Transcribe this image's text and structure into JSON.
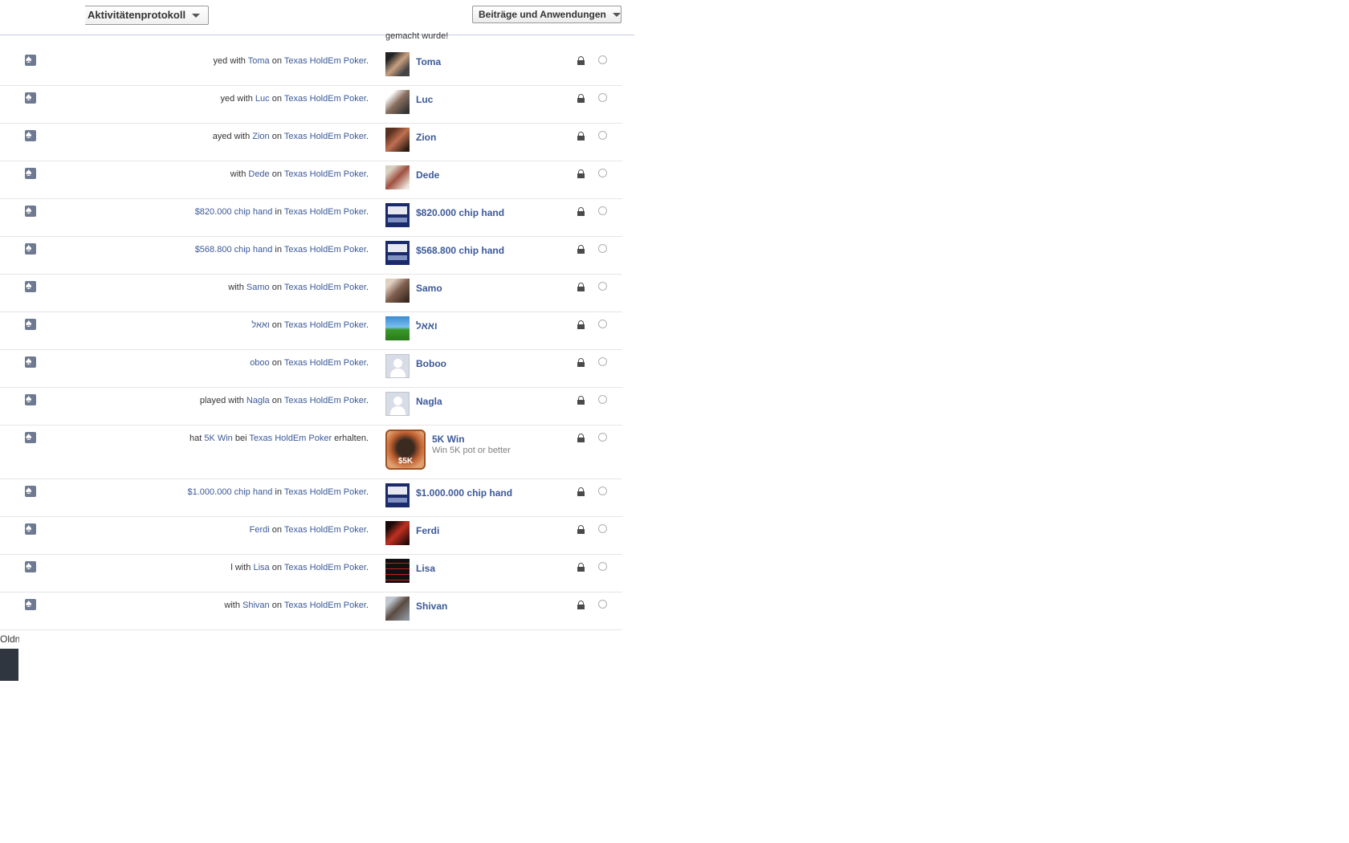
{
  "header": {
    "title": "Aktivitätenprotokoll",
    "filter_label": "Beiträge und Anwendungen",
    "prev_text": "gemacht wurde!"
  },
  "rows": [
    {
      "story_pre": "yed with ",
      "link1": "Toma",
      "mid": " on ",
      "link2": "Texas HoldEm Poker",
      "post": ".",
      "name": "Toma",
      "thumb": "face1"
    },
    {
      "story_pre": "yed with ",
      "link1": "Luc",
      "mid": " on ",
      "link2": "Texas HoldEm Poker",
      "post": ".",
      "name": "Luc",
      "thumb": "face2"
    },
    {
      "story_pre": "ayed with ",
      "link1": "Zion",
      "mid": " on ",
      "link2": "Texas HoldEm Poker",
      "post": ".",
      "name": "Zion",
      "thumb": "face3"
    },
    {
      "story_pre": "with ",
      "link1": "Dede",
      "mid": " on ",
      "link2": "Texas HoldEm Poker",
      "post": ".",
      "name": "Dede",
      "thumb": "face4"
    },
    {
      "story_pre": "",
      "link1": "$820.000 chip hand",
      "mid": " in ",
      "link2": "Texas HoldEm Poker",
      "post": ".",
      "name": "$820.000 chip hand",
      "thumb": "cards"
    },
    {
      "story_pre": "",
      "link1": "$568.800 chip hand",
      "mid": " in ",
      "link2": "Texas HoldEm Poker",
      "post": ".",
      "name": "$568.800 chip hand",
      "thumb": "cards"
    },
    {
      "story_pre": "with ",
      "link1": "Samo",
      "mid": " on ",
      "link2": "Texas HoldEm Poker",
      "post": ".",
      "name": "Samo",
      "thumb": "face5"
    },
    {
      "story_pre": "",
      "link1": "ואאל",
      "mid": " on ",
      "link2": "Texas HoldEm Poker",
      "post": ".",
      "name": "ואאל",
      "thumb": "landscape"
    },
    {
      "story_pre": "",
      "link1": "oboo",
      "mid": " on ",
      "link2": "Texas HoldEm Poker",
      "post": ".",
      "name": "Boboo",
      "thumb": "silhouette"
    },
    {
      "story_pre": "played with ",
      "link1": "Nagla",
      "mid": " on ",
      "link2": "Texas HoldEm Poker",
      "post": ".",
      "name": "Nagla",
      "thumb": "silhouette"
    },
    {
      "story_pre": "hat ",
      "link1": "5K Win",
      "mid": " bei ",
      "link2": "Texas HoldEm Poker",
      "post": " erhalten.",
      "name": "5K Win",
      "sub": "Win 5K pot or better",
      "thumb": "pot",
      "pot_label": "$5K"
    },
    {
      "story_pre": "",
      "link1": "$1.000.000 chip hand",
      "mid": " in ",
      "link2": "Texas HoldEm Poker",
      "post": ".",
      "name": "$1.000.000 chip hand",
      "thumb": "cards"
    },
    {
      "story_pre": "",
      "link1": "Ferdi",
      "mid": " on ",
      "link2": "Texas HoldEm Poker",
      "post": ".",
      "name": "Ferdi",
      "thumb": "face6"
    },
    {
      "story_pre": "l with ",
      "link1": "Lisa",
      "mid": " on ",
      "link2": "Texas HoldEm Poker",
      "post": ".",
      "name": "Lisa",
      "thumb": "grid"
    },
    {
      "story_pre": "with ",
      "link1": "Shivan",
      "mid": " on ",
      "link2": "Texas HoldEm Poker",
      "post": ".",
      "name": "Shivan",
      "thumb": "face7"
    }
  ],
  "side": {
    "text": "Oldn"
  }
}
